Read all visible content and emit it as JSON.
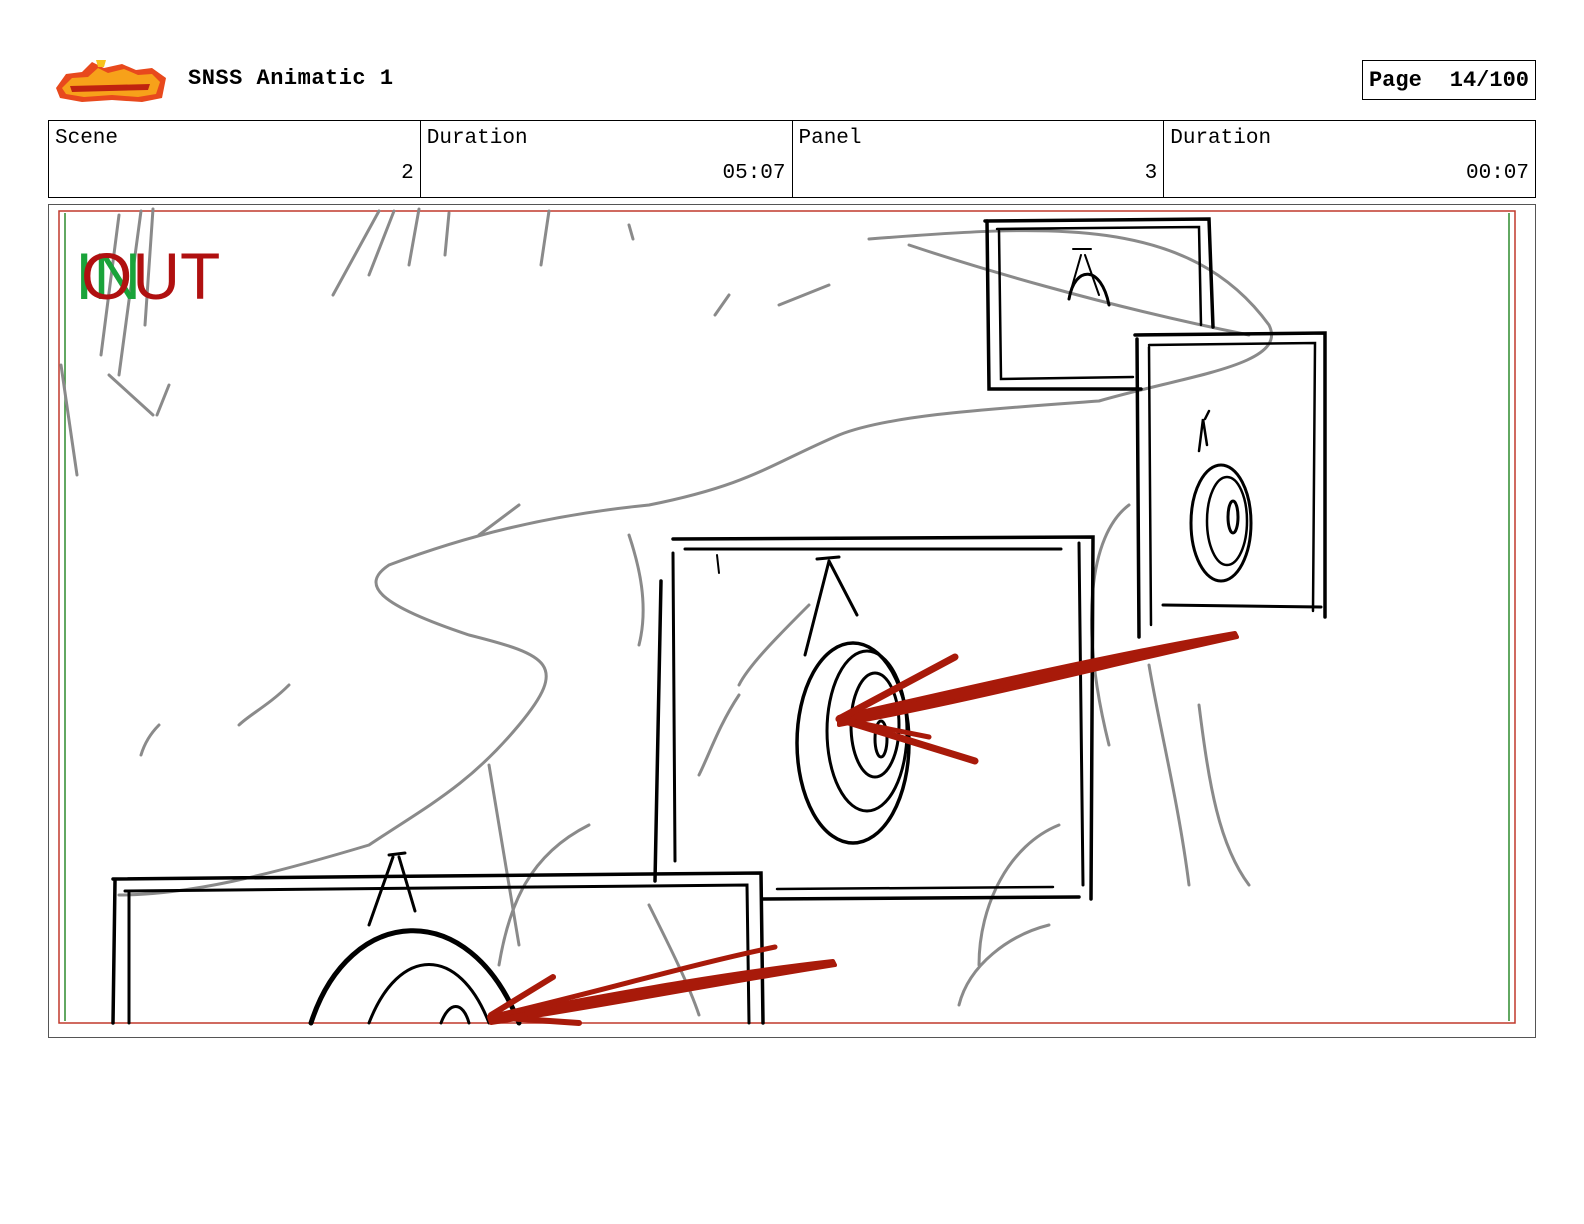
{
  "header": {
    "title": "SNSS Animatic 1",
    "page_label": "Page",
    "page_number": "14/100"
  },
  "info": {
    "scene_label": "Scene",
    "scene_value": "2",
    "scene_duration_label": "Duration",
    "scene_duration_value": "05:07",
    "panel_label": "Panel",
    "panel_value": "3",
    "panel_duration_label": "Duration",
    "panel_duration_value": "00:07"
  },
  "frame": {
    "in_marker": "IN",
    "out_marker": "OUT"
  },
  "colors": {
    "sketch_gray": "#8a8a8a",
    "ink": "#000000",
    "arrow_red": "#a81a0a",
    "in_green": "#1aa33a",
    "out_red": "#b01010",
    "safe_red": "#c0392b",
    "safe_green": "#2e8b2e"
  }
}
